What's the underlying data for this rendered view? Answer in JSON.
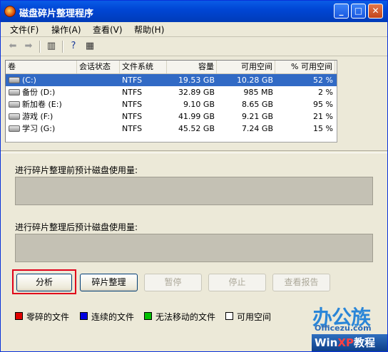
{
  "window": {
    "title": "磁盘碎片整理程序",
    "min": "_",
    "max": "□",
    "close": "✕"
  },
  "menu": [
    "文件(F)",
    "操作(A)",
    "查看(V)",
    "帮助(H)"
  ],
  "columns": [
    "卷",
    "会话状态",
    "文件系统",
    "容量",
    "可用空间",
    "% 可用空间"
  ],
  "volumes": [
    {
      "name": "(C:)",
      "status": "",
      "fs": "NTFS",
      "capacity": "19.53 GB",
      "free": "10.28 GB",
      "pct": "52 %"
    },
    {
      "name": "备份 (D:)",
      "status": "",
      "fs": "NTFS",
      "capacity": "32.89 GB",
      "free": "985 MB",
      "pct": "2 %"
    },
    {
      "name": "新加卷 (E:)",
      "status": "",
      "fs": "NTFS",
      "capacity": "9.10 GB",
      "free": "8.65 GB",
      "pct": "95 %"
    },
    {
      "name": "游戏 (F:)",
      "status": "",
      "fs": "NTFS",
      "capacity": "41.99 GB",
      "free": "9.21 GB",
      "pct": "21 %"
    },
    {
      "name": "学习 (G:)",
      "status": "",
      "fs": "NTFS",
      "capacity": "45.52 GB",
      "free": "7.24 GB",
      "pct": "15 %"
    }
  ],
  "labels": {
    "before": "进行碎片整理前预计磁盘使用量:",
    "after": "进行碎片整理后预计磁盘使用量:"
  },
  "buttons": {
    "analyze": "分析",
    "defrag": "碎片整理",
    "pause": "暂停",
    "stop": "停止",
    "report": "查看报告"
  },
  "legend": [
    {
      "label": "零碎的文件",
      "color": "#e00000"
    },
    {
      "label": "连续的文件",
      "color": "#0000e0"
    },
    {
      "label": "无法移动的文件",
      "color": "#00c000"
    },
    {
      "label": "可用空间",
      "color": "#ffffff"
    }
  ],
  "watermark": {
    "brand": "办公族",
    "site": "Officezu.com",
    "win": "Win",
    "xp": "XP",
    "suffix": "教程"
  },
  "colors": {
    "selection": "#316ac5",
    "titlebar": "#0046d5",
    "focus_ring": "#e0001a"
  }
}
